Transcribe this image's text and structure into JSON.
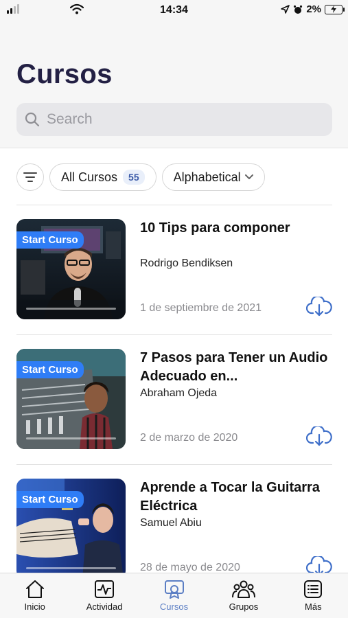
{
  "status": {
    "time": "14:34",
    "battery": "2%"
  },
  "header": {
    "title": "Cursos",
    "search_placeholder": "Search"
  },
  "filters": {
    "scope_label": "All Cursos",
    "scope_count": "55",
    "sort_label": "Alphabetical"
  },
  "courses": [
    {
      "badge": "Start Curso",
      "title": "10 Tips para componer",
      "author": "Rodrigo Bendiksen",
      "date": "1 de septiembre de 2021"
    },
    {
      "badge": "Start Curso",
      "title": "7 Pasos para Tener un Audio Adecuado en...",
      "author": "Abraham Ojeda",
      "date": "2 de marzo de 2020"
    },
    {
      "badge": "Start Curso",
      "title": "Aprende a Tocar la Guitarra Eléctrica",
      "author": "Samuel Abiu",
      "date": "28 de mayo de 2020"
    }
  ],
  "tabs": [
    {
      "label": "Inicio",
      "icon": "home-icon"
    },
    {
      "label": "Actividad",
      "icon": "activity-icon"
    },
    {
      "label": "Cursos",
      "icon": "certificate-icon",
      "active": true
    },
    {
      "label": "Grupos",
      "icon": "groups-icon"
    },
    {
      "label": "Más",
      "icon": "menu-list-icon"
    }
  ],
  "colors": {
    "accent": "#2f7df6",
    "title": "#232044",
    "active_tab": "#5b7ec4",
    "download": "#3f6fc9"
  }
}
